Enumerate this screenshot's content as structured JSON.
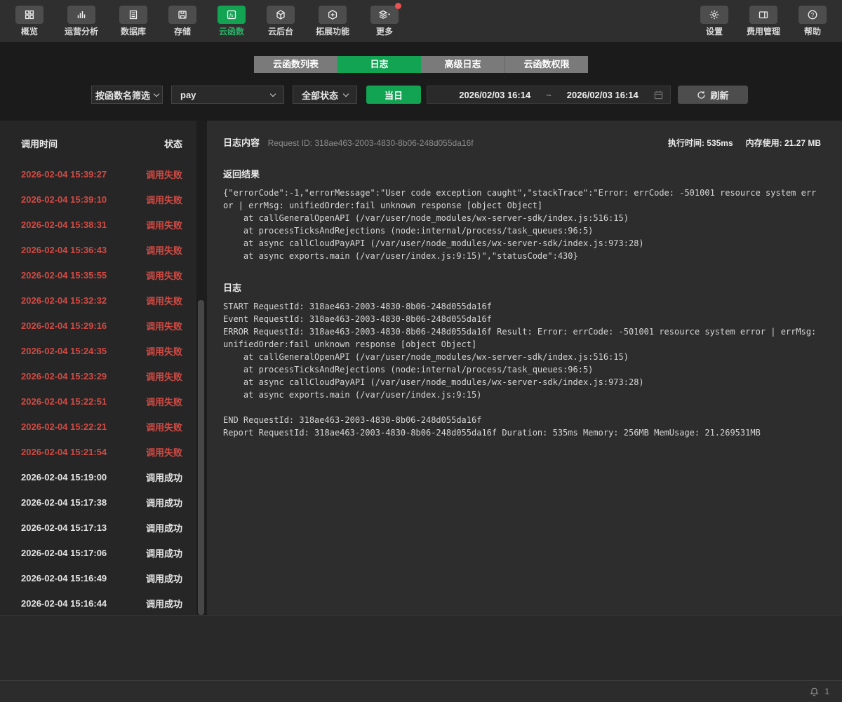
{
  "colors": {
    "accent_green": "#12a452",
    "fail_red": "#d14a44",
    "success_text": "#e4e4e4",
    "notification_red": "#ec5151",
    "topbar_bg": "#2f2f2f",
    "page_bg": "#1b1b1b",
    "left_panel_bg": "#262626",
    "right_panel_bg": "#2d2d2d",
    "tab_inactive_bg": "#7a7a7a"
  },
  "top_nav": {
    "left_items": [
      {
        "name": "overview",
        "label": "概览",
        "icon": "grid-icon",
        "active": false
      },
      {
        "name": "analysis",
        "label": "运营分析",
        "icon": "bar-chart-icon",
        "active": false
      },
      {
        "name": "database",
        "label": "数据库",
        "icon": "list-icon",
        "active": false
      },
      {
        "name": "storage",
        "label": "存储",
        "icon": "storage-icon",
        "active": false
      },
      {
        "name": "cloud-function",
        "label": "云函数",
        "icon": "fx-icon",
        "active": true
      },
      {
        "name": "cloud-backend",
        "label": "云后台",
        "icon": "cube-icon",
        "active": false
      },
      {
        "name": "extensions",
        "label": "拓展功能",
        "icon": "hexagon-plus-icon",
        "active": false
      },
      {
        "name": "more",
        "label": "更多",
        "icon": "layers-icon",
        "active": false,
        "badge": true
      }
    ],
    "right_items": [
      {
        "name": "settings",
        "label": "设置",
        "icon": "gear-icon",
        "active": false
      },
      {
        "name": "billing",
        "label": "费用管理",
        "icon": "billing-icon",
        "active": false
      },
      {
        "name": "help",
        "label": "帮助",
        "icon": "help-icon",
        "active": false
      }
    ]
  },
  "tabs": [
    {
      "label": "云函数列表",
      "active": false
    },
    {
      "label": "日志",
      "active": true
    },
    {
      "label": "高级日志",
      "active": false
    },
    {
      "label": "云函数权限",
      "active": false
    }
  ],
  "filters": {
    "filter_type": "按函数名筛选",
    "function_name": "pay",
    "status_filter": "全部状态",
    "today_button": "当日",
    "date_from": "2026/02/03 16:14",
    "range_separator": "~",
    "date_to": "2026/02/03 16:14",
    "refresh_button": "刷新"
  },
  "call_list": {
    "columns": {
      "time": "调用时间",
      "status": "状态"
    },
    "status_fail_label": "调用失败",
    "status_success_label": "调用成功",
    "rows": [
      {
        "time": "2026-02-04 15:39:27",
        "status": "调用失败",
        "type": "fail"
      },
      {
        "time": "2026-02-04 15:39:10",
        "status": "调用失败",
        "type": "fail"
      },
      {
        "time": "2026-02-04 15:38:31",
        "status": "调用失败",
        "type": "fail"
      },
      {
        "time": "2026-02-04 15:36:43",
        "status": "调用失败",
        "type": "fail"
      },
      {
        "time": "2026-02-04 15:35:55",
        "status": "调用失败",
        "type": "fail"
      },
      {
        "time": "2026-02-04 15:32:32",
        "status": "调用失败",
        "type": "fail"
      },
      {
        "time": "2026-02-04 15:29:16",
        "status": "调用失败",
        "type": "fail"
      },
      {
        "time": "2026-02-04 15:24:35",
        "status": "调用失败",
        "type": "fail"
      },
      {
        "time": "2026-02-04 15:23:29",
        "status": "调用失败",
        "type": "fail"
      },
      {
        "time": "2026-02-04 15:22:51",
        "status": "调用失败",
        "type": "fail"
      },
      {
        "time": "2026-02-04 15:22:21",
        "status": "调用失败",
        "type": "fail"
      },
      {
        "time": "2026-02-04 15:21:54",
        "status": "调用失败",
        "type": "fail"
      },
      {
        "time": "2026-02-04 15:19:00",
        "status": "调用成功",
        "type": "success"
      },
      {
        "time": "2026-02-04 15:17:38",
        "status": "调用成功",
        "type": "success"
      },
      {
        "time": "2026-02-04 15:17:13",
        "status": "调用成功",
        "type": "success"
      },
      {
        "time": "2026-02-04 15:17:06",
        "status": "调用成功",
        "type": "success"
      },
      {
        "time": "2026-02-04 15:16:49",
        "status": "调用成功",
        "type": "success"
      },
      {
        "time": "2026-02-04 15:16:44",
        "status": "调用成功",
        "type": "success"
      }
    ]
  },
  "log_panel": {
    "title": "日志内容",
    "request_id_label": "Request ID: 318ae463-2003-4830-8b06-248d055da16f",
    "exec_time": "执行时间: 535ms",
    "memory": "内存使用: 21.27 MB",
    "return_section_title": "返回结果",
    "return_text": "{\"errorCode\":-1,\"errorMessage\":\"User code exception caught\",\"stackTrace\":\"Error: errCode: -501001 resource system error | errMsg: unifiedOrder:fail unknown response [object Object]\n    at callGeneralOpenAPI (/var/user/node_modules/wx-server-sdk/index.js:516:15)\n    at processTicksAndRejections (node:internal/process/task_queues:96:5)\n    at async callCloudPayAPI (/var/user/node_modules/wx-server-sdk/index.js:973:28)\n    at async exports.main (/var/user/index.js:9:15)\",\"statusCode\":430}",
    "log_section_title": "日志",
    "log_text": "START RequestId: 318ae463-2003-4830-8b06-248d055da16f\nEvent RequestId: 318ae463-2003-4830-8b06-248d055da16f\nERROR RequestId: 318ae463-2003-4830-8b06-248d055da16f Result: Error: errCode: -501001 resource system error | errMsg:\nunifiedOrder:fail unknown response [object Object]\n    at callGeneralOpenAPI (/var/user/node_modules/wx-server-sdk/index.js:516:15)\n    at processTicksAndRejections (node:internal/process/task_queues:96:5)\n    at async callCloudPayAPI (/var/user/node_modules/wx-server-sdk/index.js:973:28)\n    at async exports.main (/var/user/index.js:9:15)\n\nEND RequestId: 318ae463-2003-4830-8b06-248d055da16f\nReport RequestId: 318ae463-2003-4830-8b06-248d055da16f Duration: 535ms Memory: 256MB MemUsage: 21.269531MB"
  },
  "status_bar": {
    "bell_count": "1"
  }
}
